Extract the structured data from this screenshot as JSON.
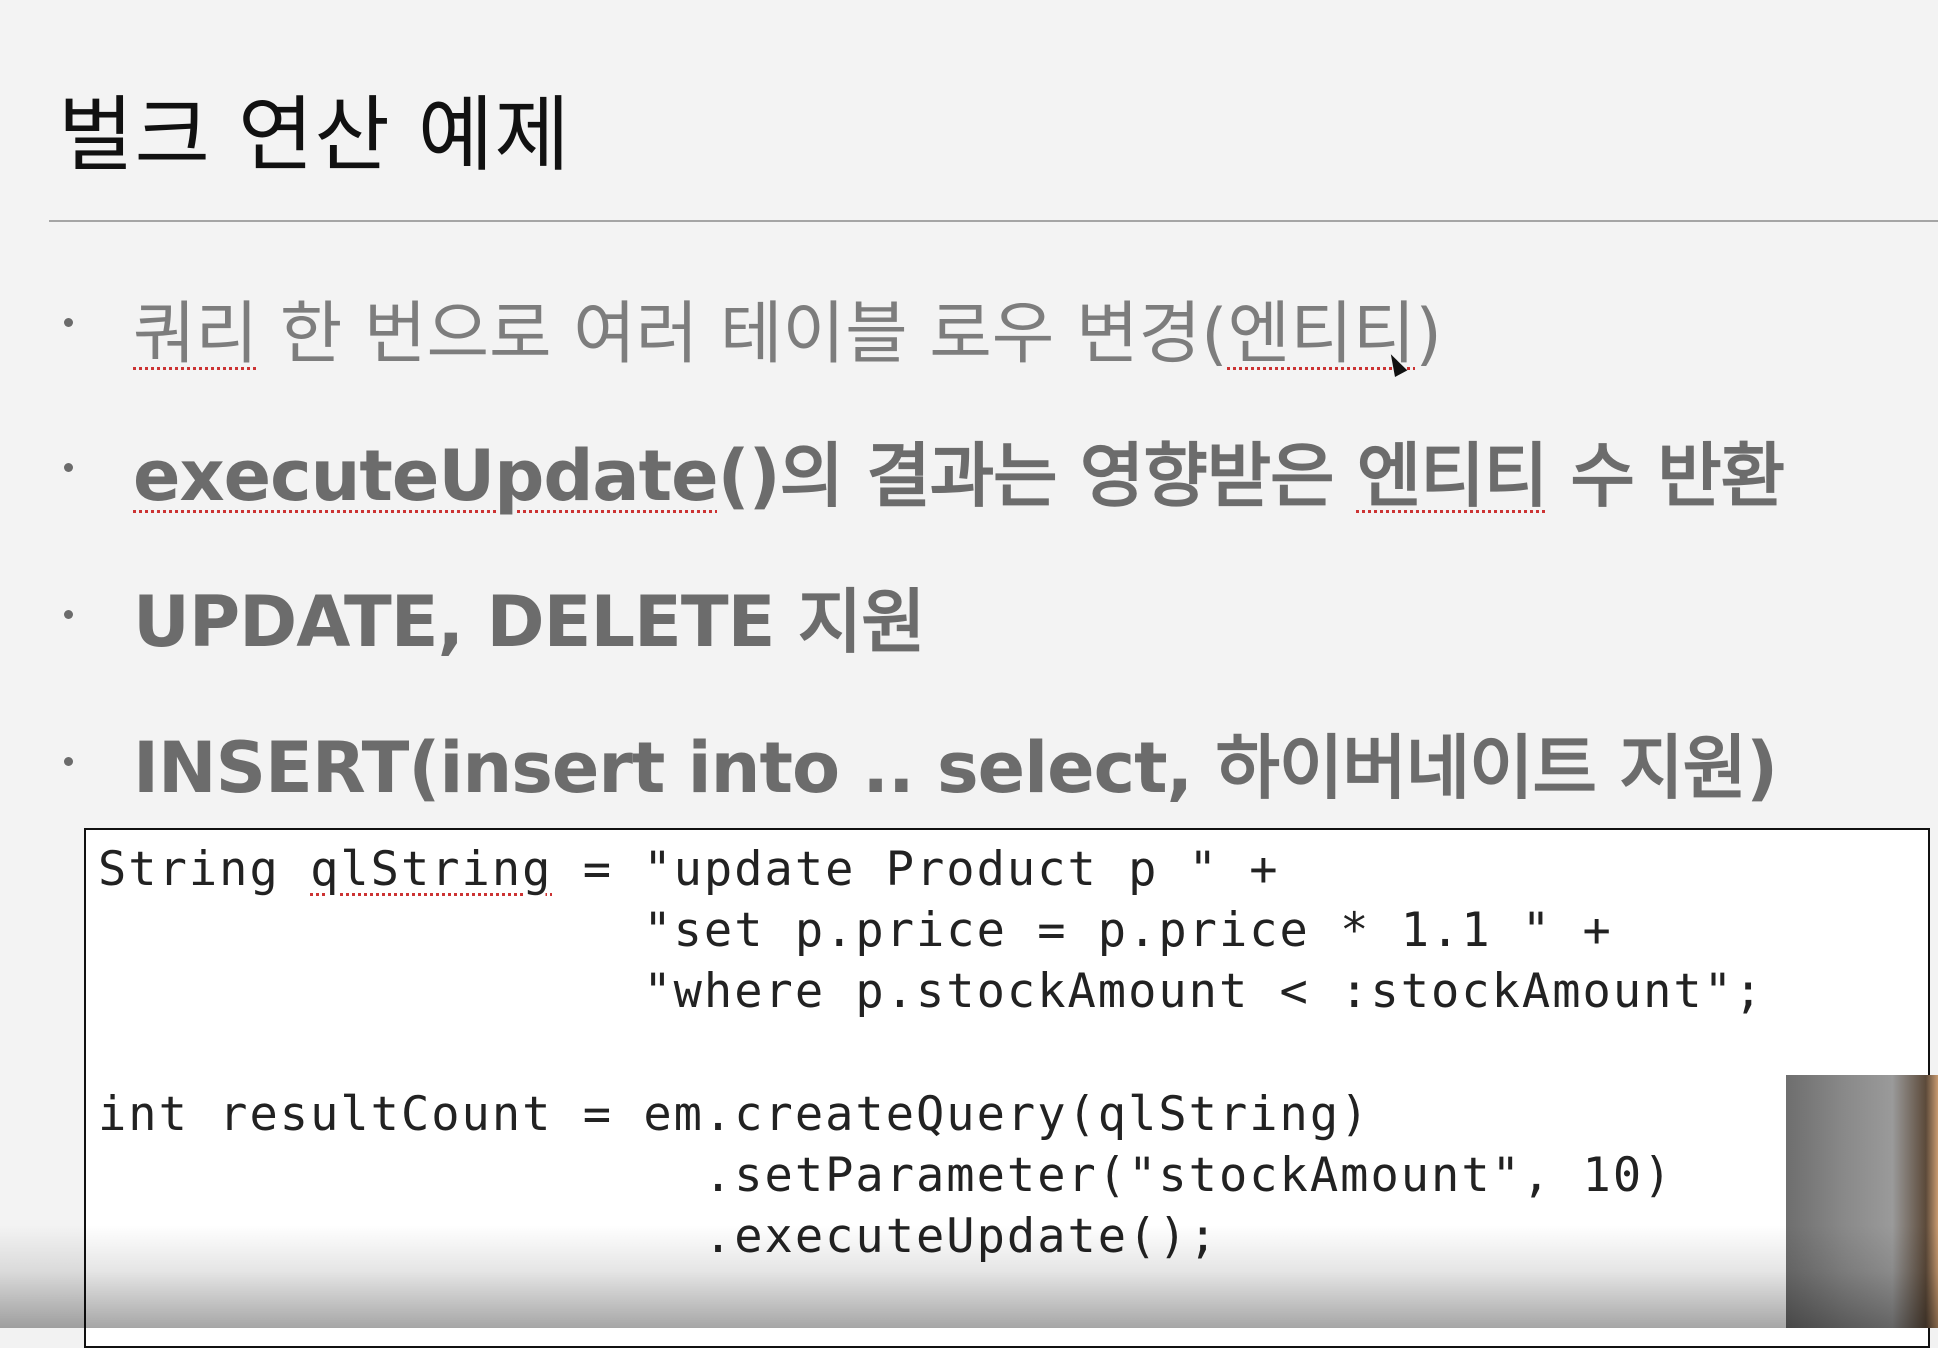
{
  "slide": {
    "title": "벌크 연산 예제",
    "bullets": [
      {
        "pre": "",
        "mark": "쿼리",
        "post": " 한 번으로 여러 테이블 로우 변경(",
        "mark2": "엔티티",
        "post2": ")"
      },
      {
        "pre": "",
        "mark": "executeUpdate",
        "post": "()의 결과는 영향받은 ",
        "mark2": "엔티티",
        "post2": " 수 반환"
      },
      {
        "pre": "UPDATE, DELETE 지원",
        "mark": "",
        "post": "",
        "mark2": "",
        "post2": ""
      },
      {
        "pre": "INSERT(insert into .. select, 하이버네이트 지원)",
        "mark": "",
        "post": "",
        "mark2": "",
        "post2": ""
      }
    ],
    "code": {
      "line1_pre": "String ",
      "line1_mark": "qlString",
      "line1_post": " = \"update Product p \" +",
      "line2": "                  \"set p.price = p.price * 1.1 \" +",
      "line3": "                  \"where p.stockAmount < :stockAmount\";",
      "line4": "",
      "line5": "int resultCount = em.createQuery(qlString)",
      "line6": "                    .setParameter(\"stockAmount\", 10)",
      "line7": "                    .executeUpdate();"
    }
  }
}
